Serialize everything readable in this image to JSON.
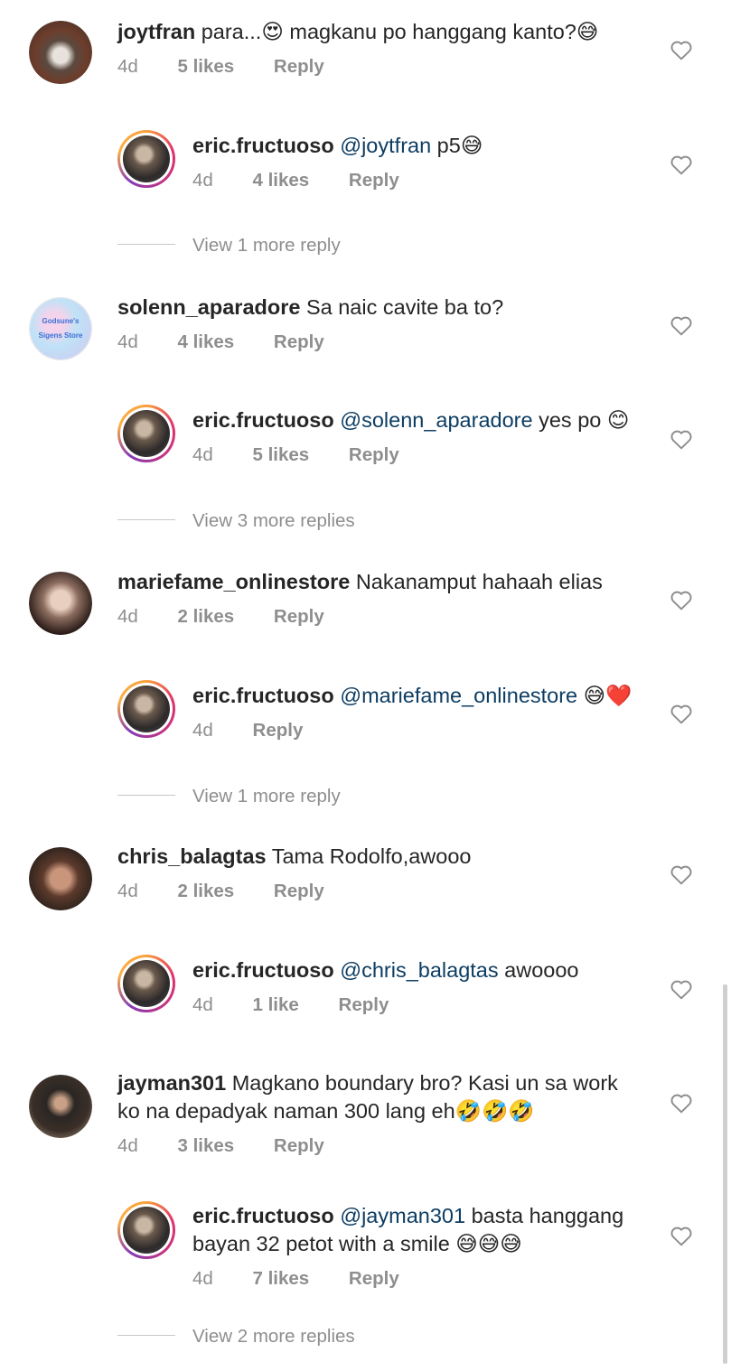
{
  "comments": [
    {
      "user": "joytfran",
      "text": "para...😍 magkanu po hanggang kanto?😅",
      "time": "4d",
      "likes": "5 likes",
      "reply": "Reply",
      "replies": [
        {
          "user": "eric.fructuoso",
          "mention": "@joytfran",
          "text": " p5😅",
          "time": "4d",
          "likes": "4 likes",
          "reply": "Reply"
        }
      ],
      "view_more": "View 1 more reply"
    },
    {
      "user": "solenn_aparadore",
      "text": "Sa naic cavite ba to?",
      "time": "4d",
      "likes": "4 likes",
      "reply": "Reply",
      "replies": [
        {
          "user": "eric.fructuoso",
          "mention": "@solenn_aparadore",
          "text": " yes po 😊",
          "time": "4d",
          "likes": "5 likes",
          "reply": "Reply"
        }
      ],
      "view_more": "View 3 more replies"
    },
    {
      "user": "mariefame_onlinestore",
      "text": "Nakanamput hahaah elias",
      "time": "4d",
      "likes": "2 likes",
      "reply": "Reply",
      "replies": [
        {
          "user": "eric.fructuoso",
          "mention": "@mariefame_onlinestore",
          "text": " 😅❤️",
          "time": "4d",
          "likes": "",
          "reply": "Reply"
        }
      ],
      "view_more": "View 1 more reply"
    },
    {
      "user": "chris_balagtas",
      "text": "Tama Rodolfo,awooo",
      "time": "4d",
      "likes": "2 likes",
      "reply": "Reply",
      "replies": [
        {
          "user": "eric.fructuoso",
          "mention": "@chris_balagtas",
          "text": " awoooo",
          "time": "4d",
          "likes": "1 like",
          "reply": "Reply"
        }
      ],
      "view_more": ""
    },
    {
      "user": "jayman301",
      "text": "Magkano boundary bro? Kasi un sa work",
      "text2": "ko na depadyak naman 300 lang eh🤣🤣🤣",
      "time": "4d",
      "likes": "3 likes",
      "reply": "Reply",
      "replies": [
        {
          "user": "eric.fructuoso",
          "mention": "@jayman301",
          "text": " basta hanggang",
          "text2": "bayan 32 petot with a smile 😅😅😅",
          "time": "4d",
          "likes": "7 likes",
          "reply": "Reply"
        }
      ],
      "view_more": "View 2 more replies"
    }
  ],
  "icons": {
    "like": "heart-outline-icon",
    "avatar_solenn_text_1": "Godsune's",
    "avatar_solenn_text_2": "Sigens Store"
  }
}
